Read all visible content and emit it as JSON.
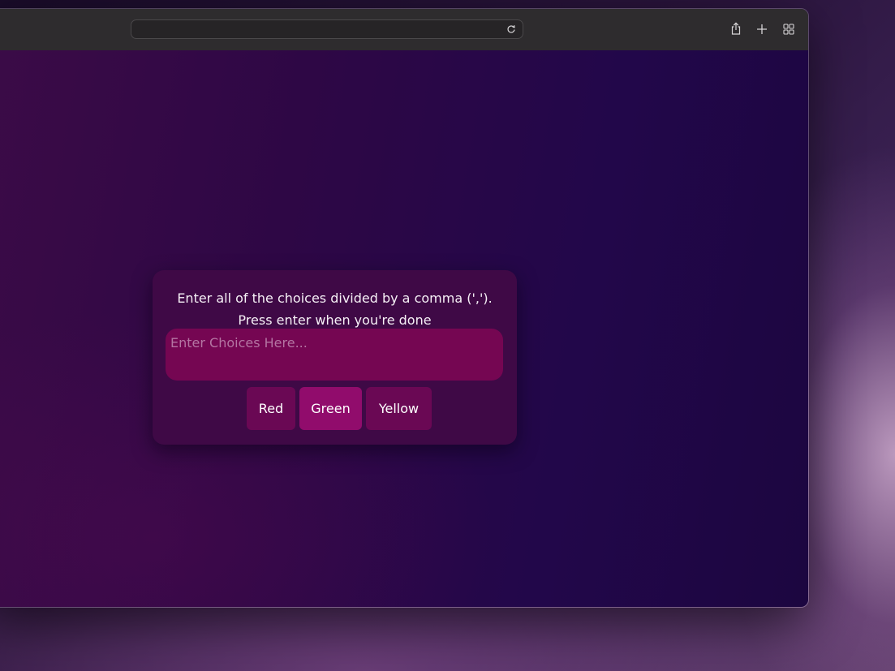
{
  "browser": {
    "address": "",
    "icons": {
      "reload": "reload-icon",
      "share": "share-icon",
      "new_tab": "plus-icon",
      "tab_overview": "tabs-grid-icon"
    }
  },
  "card": {
    "instructions_line1": "Enter all of the choices divided by a comma (',').",
    "instructions_line2": "Press enter when you're done",
    "input_placeholder": "Enter Choices Here...",
    "input_value": "",
    "choices": [
      "Red",
      "Green",
      "Yellow"
    ]
  },
  "colors": {
    "card_background": "#3f0946",
    "input_background": "#750652",
    "chip_default": "#6a0854",
    "chip_highlighted": "#910c6c",
    "page_background": "#2e0745"
  }
}
